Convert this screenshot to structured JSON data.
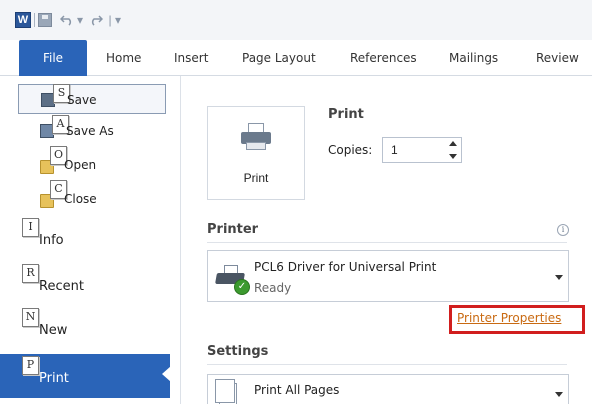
{
  "qat": {
    "word_logo": "W",
    "separator": "|",
    "undo_icon": "undo-icon",
    "dropdown_glyph": "▾",
    "redo_icon": "redo-icon"
  },
  "tabs": [
    {
      "label": "File",
      "active": true
    },
    {
      "label": "Home"
    },
    {
      "label": "Insert"
    },
    {
      "label": "Page Layout"
    },
    {
      "label": "References"
    },
    {
      "label": "Mailings"
    },
    {
      "label": "Review"
    }
  ],
  "nav": {
    "sub_items": [
      {
        "key": "S",
        "label": "Save",
        "selected": true,
        "icon": "save-icon"
      },
      {
        "key": "A",
        "label": "Save As",
        "icon": "save-as-icon"
      },
      {
        "key": "O",
        "label": "Open",
        "icon": "folder-icon"
      },
      {
        "key": "C",
        "label": "Close",
        "icon": "folder-icon"
      }
    ],
    "main_items": [
      {
        "key": "I",
        "label": "Info"
      },
      {
        "key": "R",
        "label": "Recent"
      },
      {
        "key": "N",
        "label": "New"
      },
      {
        "key": "P",
        "label": "Print",
        "active": true
      }
    ]
  },
  "print": {
    "section_title": "Print",
    "button_label": "Print",
    "copies_label": "Copies:",
    "copies_value": "1"
  },
  "printer": {
    "section_title": "Printer",
    "info_glyph": "i",
    "name": "PCL6 Driver for Universal Print",
    "status": "Ready",
    "properties_link": "Printer Properties"
  },
  "settings": {
    "section_title": "Settings",
    "selected_option": "Print All Pages"
  },
  "colors": {
    "accent": "#2a64b8",
    "highlight_box": "#d11e1e",
    "link": "#c96a12"
  }
}
